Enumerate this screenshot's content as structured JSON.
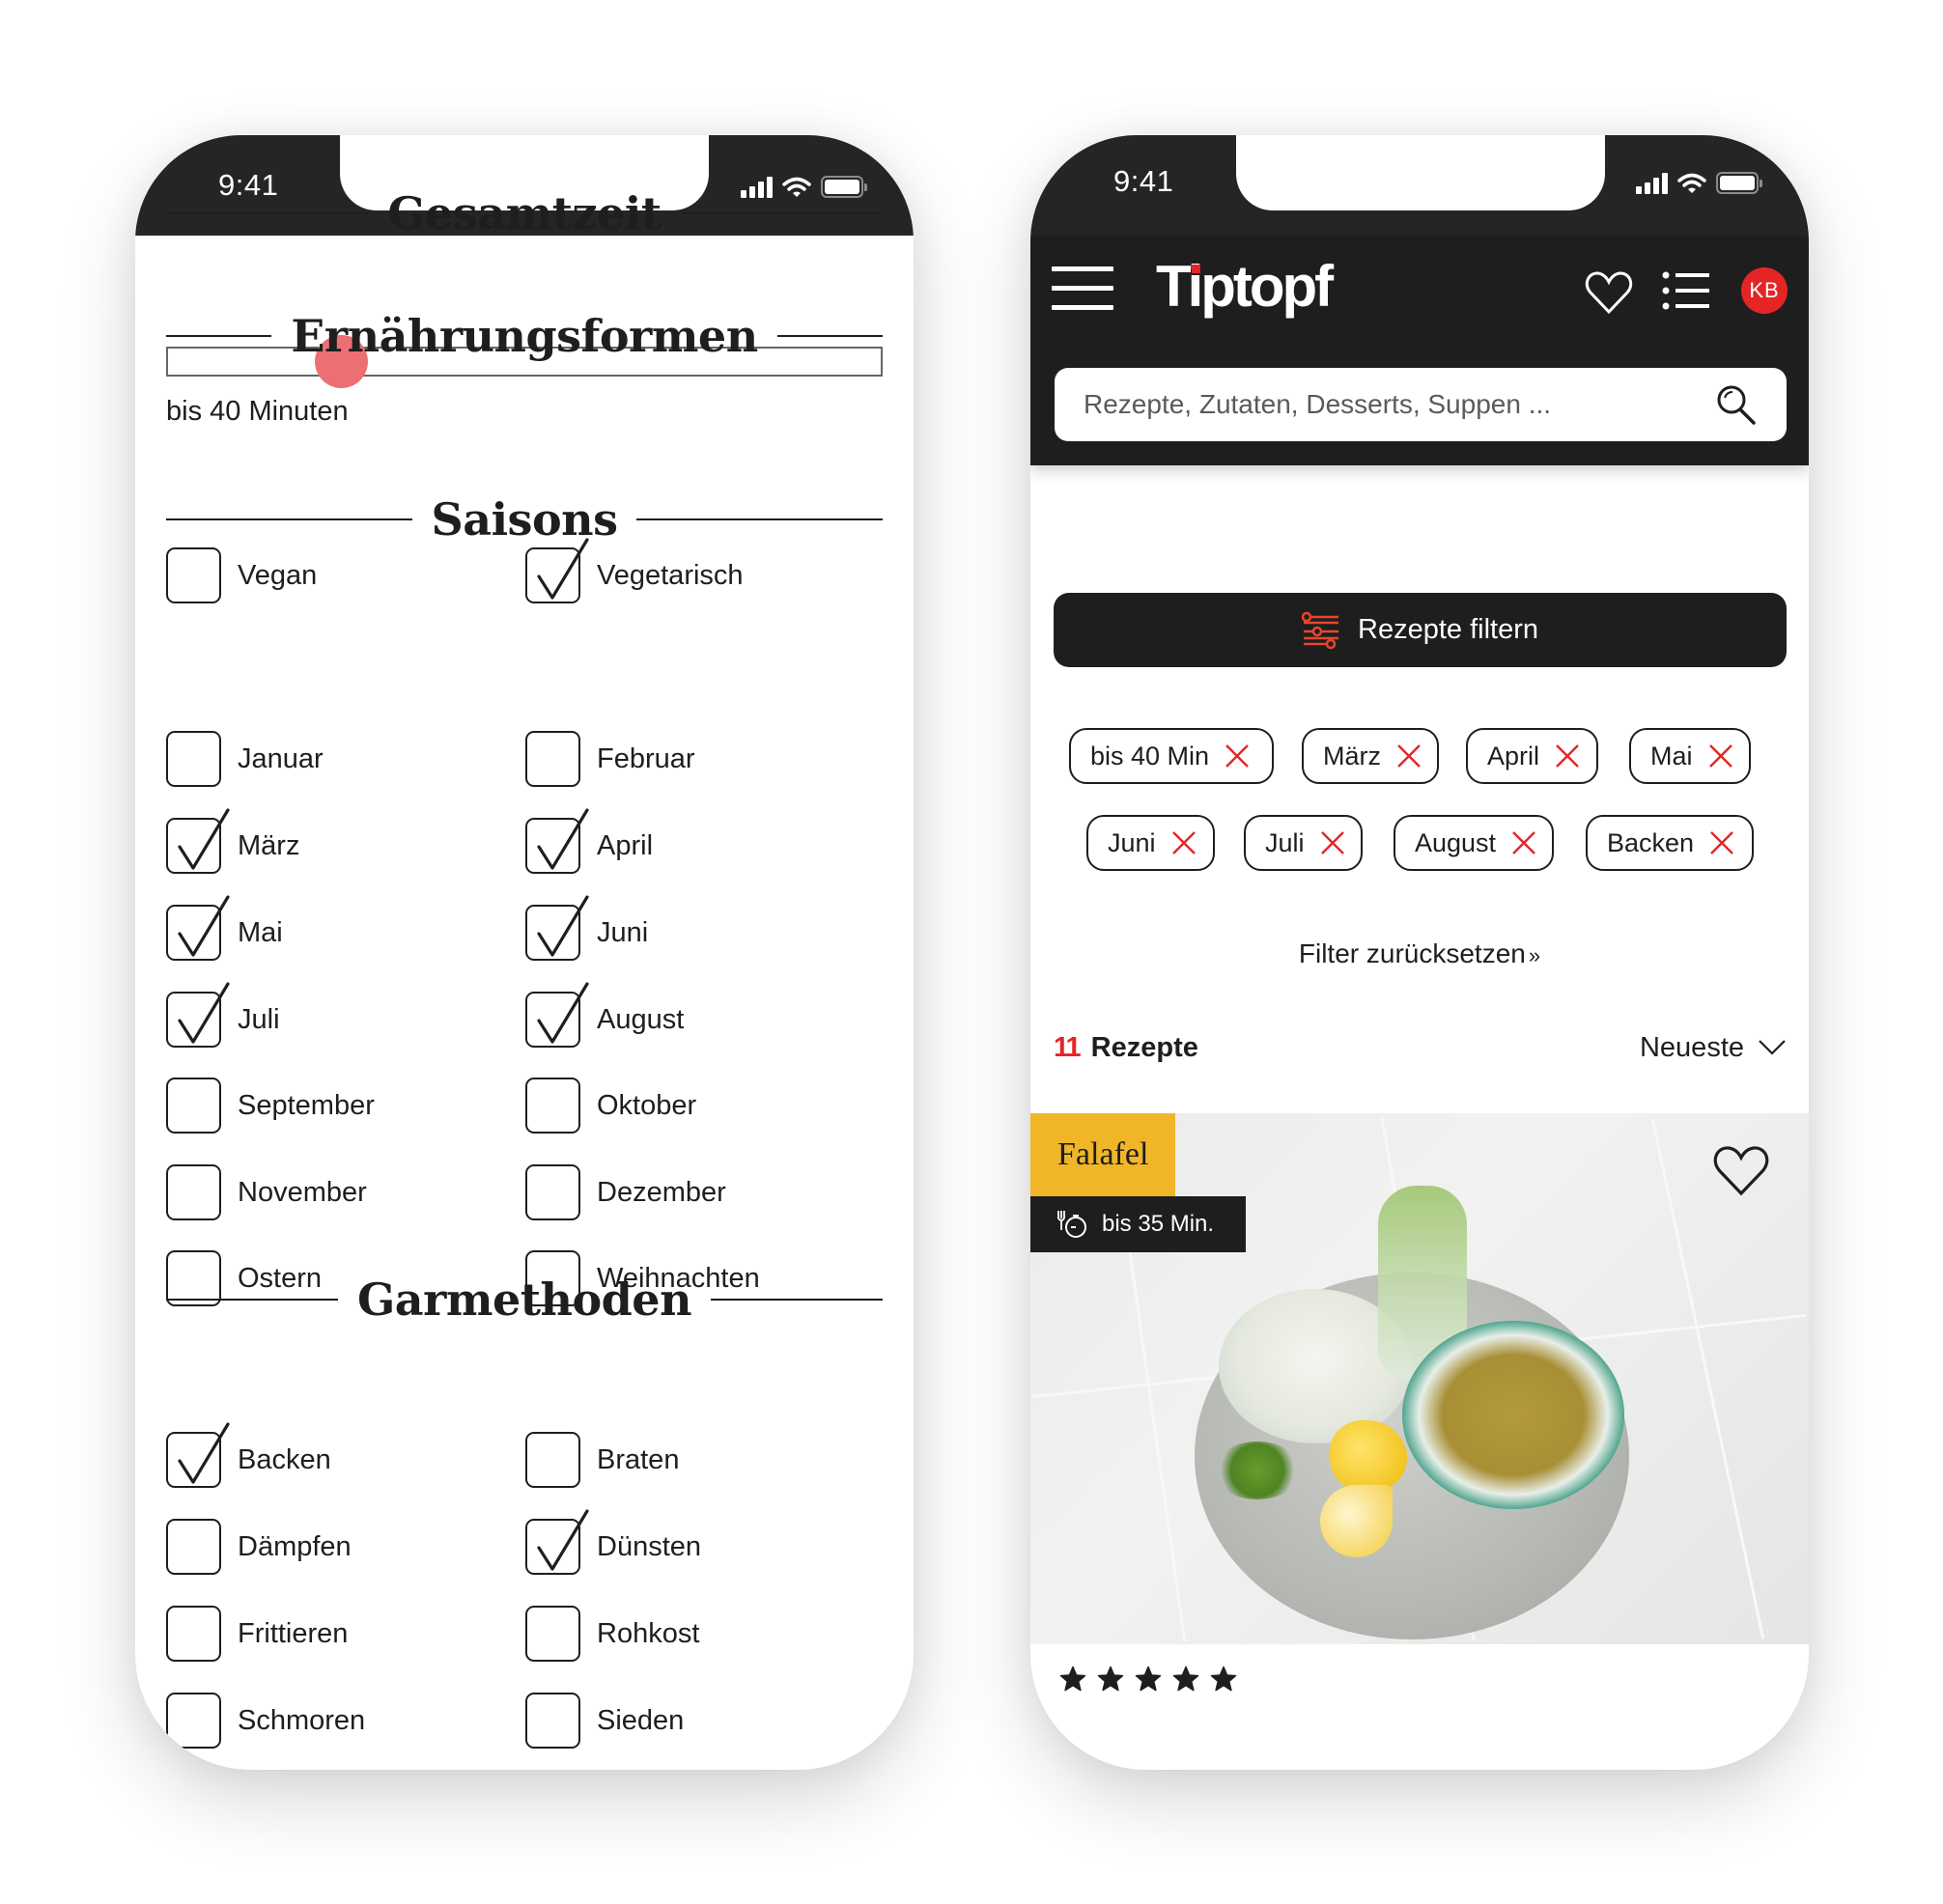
{
  "status_bar": {
    "time": "9:41",
    "icons": [
      "cellular-signal-icon",
      "wifi-icon",
      "battery-icon"
    ]
  },
  "left_screen": {
    "total_time": {
      "heading": "Gesamtzeit",
      "slider_value_fraction": 0.244,
      "caption": "bis 40 Minuten"
    },
    "sections": [
      {
        "heading": "Ernährungsformen",
        "options": [
          {
            "label": "Vegan",
            "checked": false
          },
          {
            "label": "Vegetarisch",
            "checked": true
          }
        ]
      },
      {
        "heading": "Saisons",
        "options": [
          {
            "label": "Januar",
            "checked": false
          },
          {
            "label": "Februar",
            "checked": false
          },
          {
            "label": "März",
            "checked": true
          },
          {
            "label": "April",
            "checked": true
          },
          {
            "label": "Mai",
            "checked": true
          },
          {
            "label": "Juni",
            "checked": true
          },
          {
            "label": "Juli",
            "checked": true
          },
          {
            "label": "August",
            "checked": true
          },
          {
            "label": "September",
            "checked": false
          },
          {
            "label": "Oktober",
            "checked": false
          },
          {
            "label": "November",
            "checked": false
          },
          {
            "label": "Dezember",
            "checked": false
          },
          {
            "label": "Ostern",
            "checked": false
          },
          {
            "label": "Weihnachten",
            "checked": false
          }
        ]
      },
      {
        "heading": "Garmethoden",
        "options": [
          {
            "label": "Backen",
            "checked": true
          },
          {
            "label": "Braten",
            "checked": false
          },
          {
            "label": "Dämpfen",
            "checked": false
          },
          {
            "label": "Dünsten",
            "checked": true
          },
          {
            "label": "Frittieren",
            "checked": false
          },
          {
            "label": "Rohkost",
            "checked": false
          },
          {
            "label": "Schmoren",
            "checked": false
          },
          {
            "label": "Sieden",
            "checked": false
          }
        ]
      }
    ]
  },
  "right_screen": {
    "header": {
      "logo_text": "Tiptopf",
      "avatar_initials": "KB",
      "search_placeholder": "Rezepte, Zutaten, Desserts, Suppen ..."
    },
    "filter_button_label": "Rezepte filtern",
    "active_filters": [
      "bis 40 Min",
      "März",
      "April",
      "Mai",
      "Juni",
      "Juli",
      "August",
      "Backen"
    ],
    "reset_link": "Filter zurücksetzen",
    "reset_link_suffix": "»",
    "results": {
      "count": "11",
      "label": "Rezepte",
      "sort_label": "Neueste"
    },
    "recipe_card": {
      "title": "Falafel",
      "time": "bis 35 Min.",
      "rating": 5,
      "rating_max": 5
    }
  },
  "colors": {
    "accent_red": "#e52525",
    "slider_thumb": "#ec7073",
    "title_tag_yellow": "#f1b628",
    "dark": "#1e1e1e",
    "status_bar": "#252525"
  }
}
